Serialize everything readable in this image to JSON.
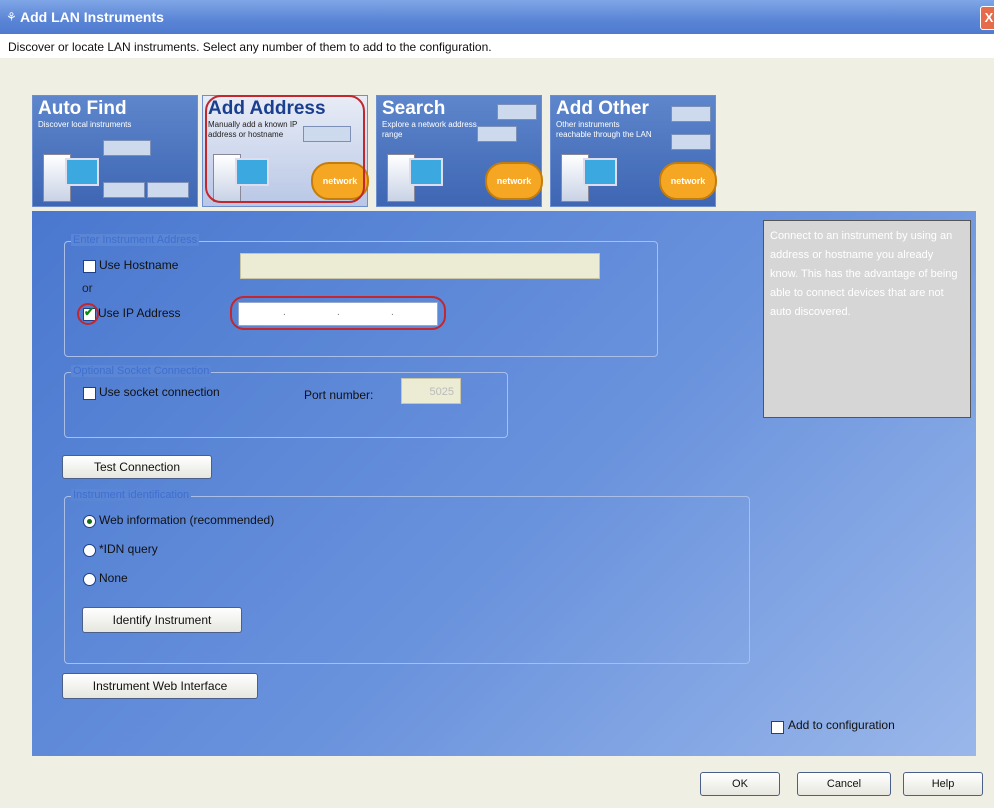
{
  "window": {
    "title": "Add LAN Instruments",
    "close_glyph": "X"
  },
  "subtitle": "Discover or locate LAN instruments. Select any number of them to add to the configuration.",
  "tabs": [
    {
      "name": "Auto Find",
      "desc": "Discover local instruments",
      "active": false
    },
    {
      "name": "Add Address",
      "desc": "Manually add a known IP address or hostname",
      "active": true
    },
    {
      "name": "Search",
      "desc": "Explore a network address range",
      "active": false
    },
    {
      "name": "Add Other",
      "desc": "Other instruments reachable through the LAN",
      "active": false
    }
  ],
  "network_label": "network",
  "address_group": {
    "title": "Enter Instrument Address",
    "use_hostname": "Use Hostname",
    "or": "or",
    "use_ip": "Use IP Address",
    "hostname_value": "",
    "ip_checked": true,
    "hostname_checked": false
  },
  "socket_group": {
    "title": "Optional Socket Connection",
    "use_socket": "Use socket connection",
    "port_label": "Port number:",
    "port_value": "5025"
  },
  "test_connection": "Test Connection",
  "ident_group": {
    "title": "Instrument identification",
    "options": [
      "Web information (recommended)",
      "*IDN query",
      "None"
    ],
    "selected": 0,
    "identify_button": "Identify Instrument"
  },
  "web_interface_button": "Instrument Web Interface",
  "info_text": "Connect to an instrument by using an address or hostname you already know. This has the advantage of being able to connect devices that are not auto discovered.",
  "add_to_config": "Add to configuration",
  "buttons": {
    "ok": "OK",
    "cancel": "Cancel",
    "help": "Help"
  },
  "colors": {
    "highlight": "#c1272d",
    "accent": "#3e66b3"
  }
}
